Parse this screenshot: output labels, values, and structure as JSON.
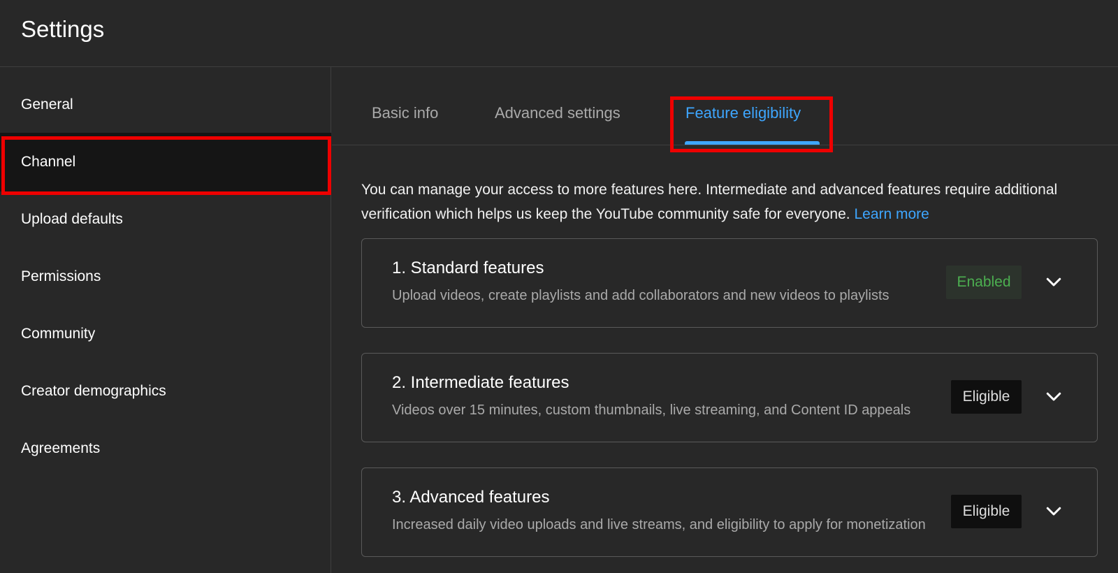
{
  "header": {
    "title": "Settings"
  },
  "sidebar": {
    "items": [
      {
        "label": "General"
      },
      {
        "label": "Channel"
      },
      {
        "label": "Upload defaults"
      },
      {
        "label": "Permissions"
      },
      {
        "label": "Community"
      },
      {
        "label": "Creator demographics"
      },
      {
        "label": "Agreements"
      }
    ],
    "active_item": "Channel"
  },
  "tabs": {
    "items": [
      {
        "label": "Basic info"
      },
      {
        "label": "Advanced settings"
      },
      {
        "label": "Feature eligibility"
      }
    ],
    "active_tab": "Feature eligibility"
  },
  "intro": {
    "text": "You can manage your access to more features here. Intermediate and advanced features require additional verification which helps us keep the YouTube community safe for everyone.",
    "link_label": "Learn more"
  },
  "features": [
    {
      "title": "1. Standard features",
      "description": "Upload videos, create playlists and add collaborators and new videos to playlists",
      "status": "Enabled"
    },
    {
      "title": "2. Intermediate features",
      "description": "Videos over 15 minutes, custom thumbnails, live streaming, and Content ID appeals",
      "status": "Eligible"
    },
    {
      "title": "3. Advanced features",
      "description": "Increased daily video uploads and live streams, and eligibility to apply for monetization",
      "status": "Eligible"
    }
  ],
  "icons": {
    "expand": "chevron-down-icon"
  },
  "colors": {
    "accent": "#3ea6ff",
    "enabled": "#4caf50",
    "highlight": "#ee0000",
    "background": "#282828"
  }
}
